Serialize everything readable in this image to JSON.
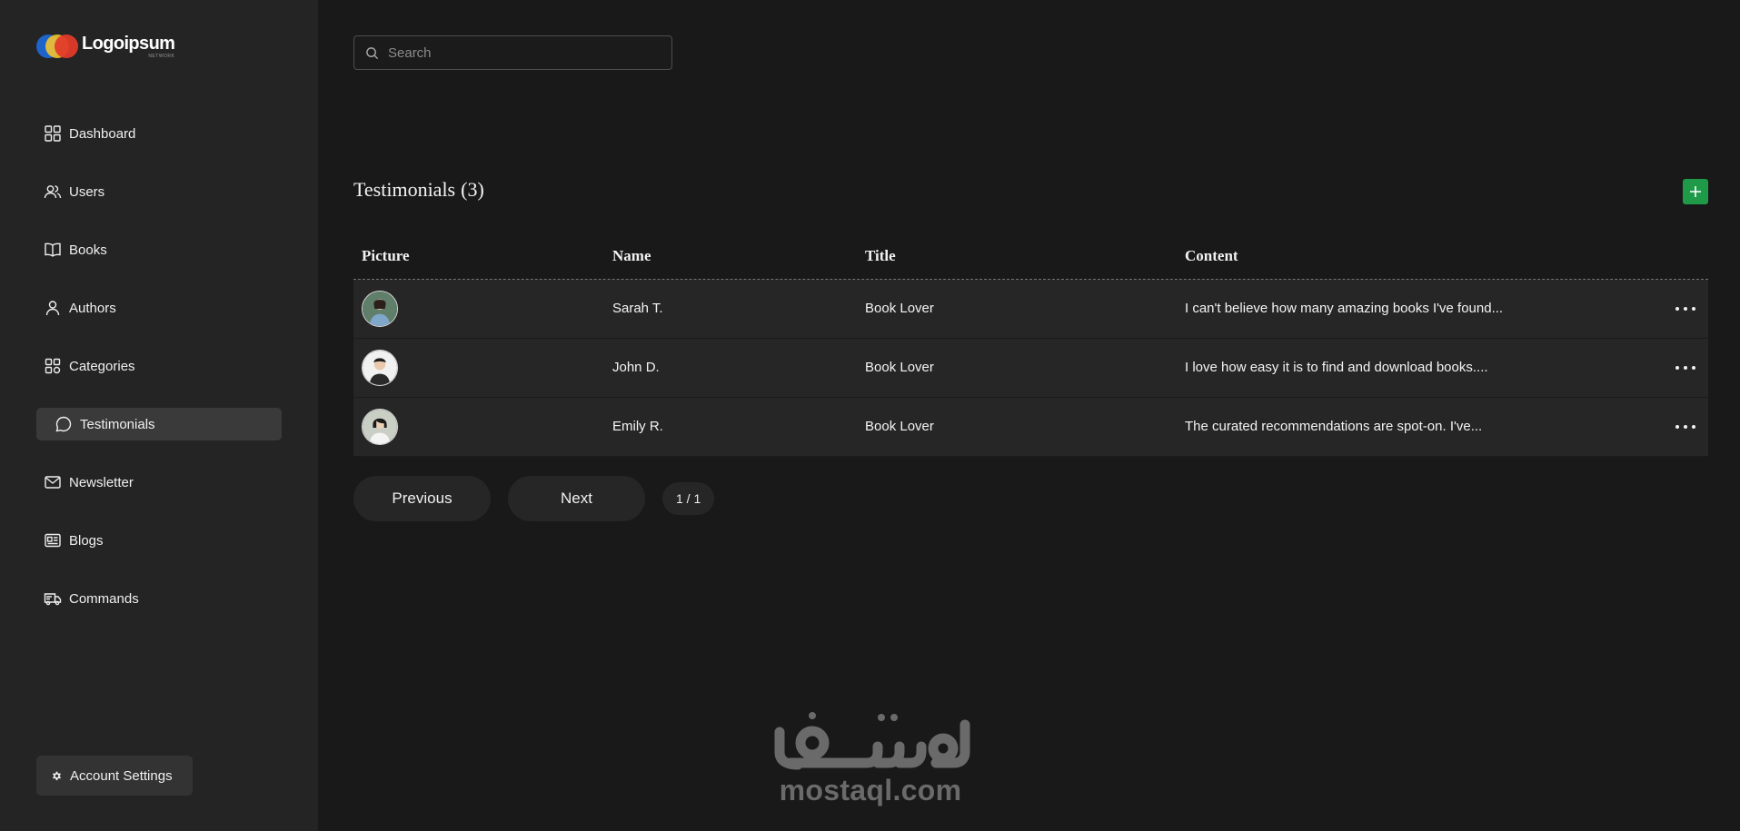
{
  "brand": {
    "name": "Logoipsum",
    "tagline": "NETWORK"
  },
  "sidebar": {
    "items": [
      {
        "label": "Dashboard",
        "icon": "dashboard-grid-icon"
      },
      {
        "label": "Users",
        "icon": "users-icon"
      },
      {
        "label": "Books",
        "icon": "book-icon"
      },
      {
        "label": "Authors",
        "icon": "user-icon"
      },
      {
        "label": "Categories",
        "icon": "categories-icon"
      },
      {
        "label": "Testimonials",
        "icon": "message-circle-icon",
        "active": true
      },
      {
        "label": "Newsletter",
        "icon": "mail-icon"
      },
      {
        "label": "Blogs",
        "icon": "newspaper-icon"
      },
      {
        "label": "Commands",
        "icon": "truck-icon"
      }
    ],
    "account_label": "Account Settings"
  },
  "search": {
    "placeholder": "Search"
  },
  "page": {
    "title": "Testimonials",
    "count": "(3)"
  },
  "table": {
    "columns": [
      "Picture",
      "Name",
      "Title",
      "Content"
    ],
    "rows": [
      {
        "name": "Sarah T.",
        "title": "Book Lover",
        "content": "I can't believe how many amazing books I've found..."
      },
      {
        "name": "John D.",
        "title": "Book Lover",
        "content": "I love how easy it is to find and download books...."
      },
      {
        "name": "Emily R.",
        "title": "Book Lover",
        "content": "The curated recommendations are spot-on. I've..."
      }
    ]
  },
  "pagination": {
    "previous": "Previous",
    "next": "Next",
    "indicator": "1 / 1"
  },
  "watermark": {
    "arabic": "مستقل",
    "text": "mostaql.com"
  },
  "colors": {
    "background": "#191919",
    "sidebar": "#242424",
    "accent_green": "#1f9a48",
    "row_background": "#262626"
  }
}
